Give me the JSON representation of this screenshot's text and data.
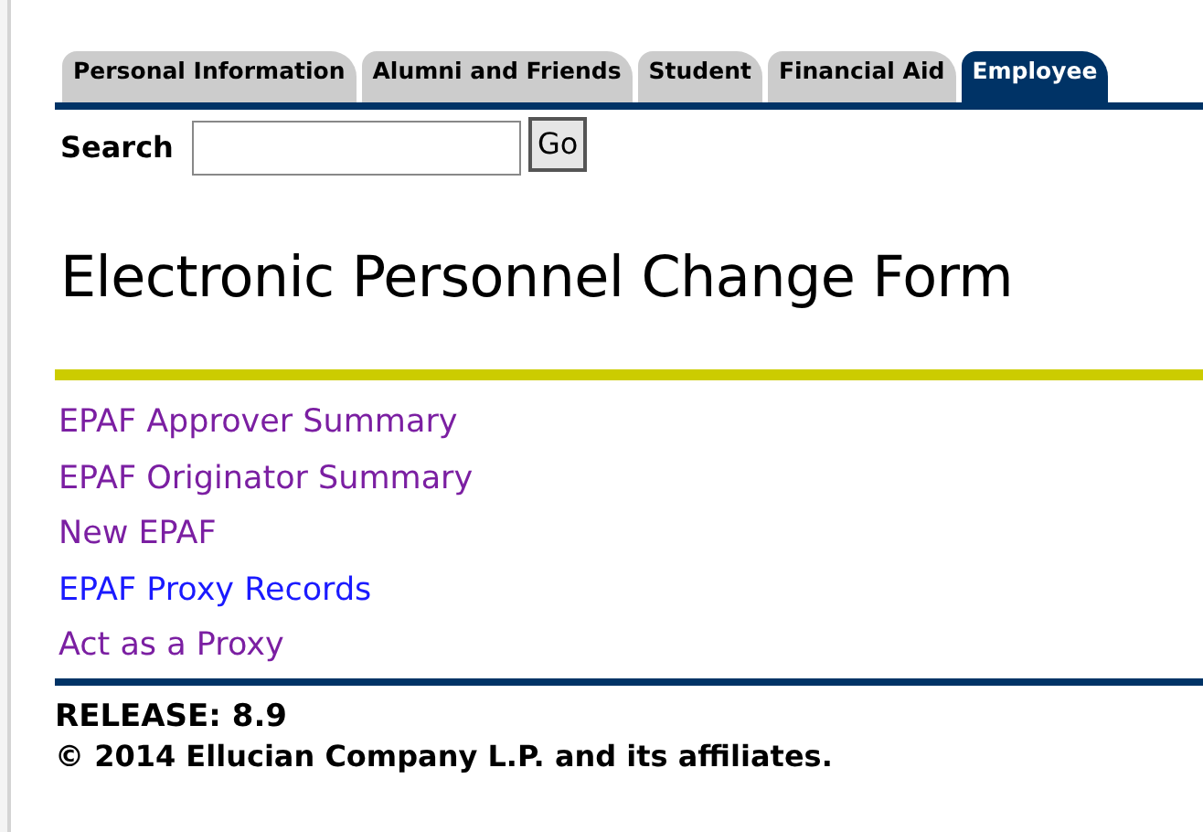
{
  "tabs": [
    {
      "label": "Personal Information",
      "selected": false
    },
    {
      "label": "Alumni and Friends",
      "selected": false
    },
    {
      "label": "Student",
      "selected": false
    },
    {
      "label": "Financial Aid",
      "selected": false
    },
    {
      "label": "Employee",
      "selected": true
    }
  ],
  "search": {
    "label": "Search",
    "button": "Go"
  },
  "title": "Electronic Personnel Change Form",
  "links": [
    {
      "label": "EPAF Approver Summary",
      "visited": true
    },
    {
      "label": "EPAF Originator Summary",
      "visited": true
    },
    {
      "label": "New EPAF",
      "visited": true
    },
    {
      "label": "EPAF Proxy Records",
      "visited": false
    },
    {
      "label": "Act as a Proxy",
      "visited": true
    }
  ],
  "footer": {
    "release": "RELEASE: 8.9",
    "copyright": "© 2014 Ellucian Company L.P. and its affiliates."
  }
}
